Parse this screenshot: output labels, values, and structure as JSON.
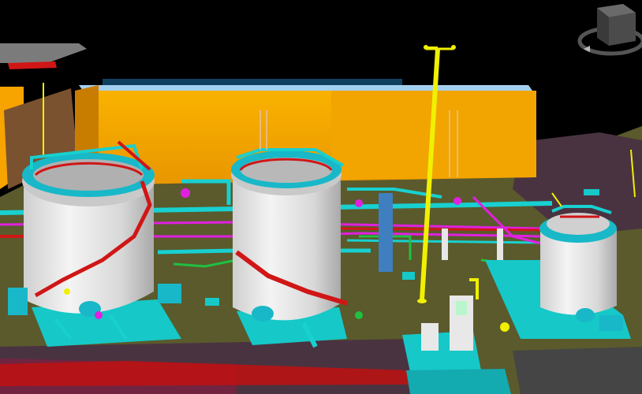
{
  "viewer": {
    "background_color": "#000000",
    "mode": "3d-plant-model-viewport"
  },
  "palette": {
    "ground": "#5a5a2c",
    "ground_dark": "#4a4a24",
    "road": "#4a3340",
    "orange_building": "#f7a300",
    "orange_shade": "#c97d00",
    "tank_body": "#e6e6e6",
    "tank_shade": "#b8b8b8",
    "cyan": "#18d0d0",
    "red": "#d01616",
    "yellow": "#f0f000",
    "magenta": "#e020e0",
    "green": "#20c040",
    "brown_wall": "#7a5230"
  },
  "model_objects": {
    "tanks": [
      "storage-tank",
      "storage-tank",
      "storage-tank"
    ],
    "structures": [
      "pipe-rack-building",
      "light-mast",
      "pump-house"
    ]
  },
  "navigation": {
    "viewcube_icon": "cube-icon",
    "orbit_ring_icon": "orbit-ring-icon"
  }
}
